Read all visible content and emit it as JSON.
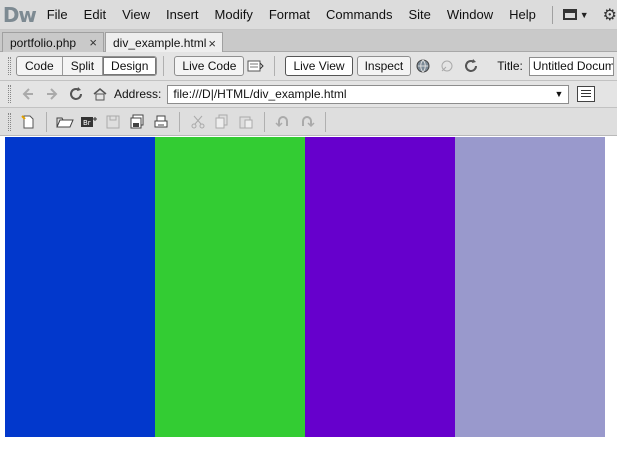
{
  "app": {
    "logo": "Dw"
  },
  "menu": [
    "File",
    "Edit",
    "View",
    "Insert",
    "Modify",
    "Format",
    "Commands",
    "Site",
    "Window",
    "Help"
  ],
  "tabs": [
    {
      "label": "portfolio.php",
      "close": "×"
    },
    {
      "label": "div_example.html",
      "close": "×"
    }
  ],
  "doc_toolbar": {
    "views": [
      "Code",
      "Split",
      "Design"
    ],
    "active_view": "Design",
    "live_code": "Live Code",
    "live_view": "Live View",
    "inspect": "Inspect",
    "title_label": "Title:",
    "title_value": "Untitled Document"
  },
  "browser": {
    "address_label": "Address:",
    "address_value": "file:///D|/HTML/div_example.html"
  },
  "columns": [
    {
      "color": "#0238cc"
    },
    {
      "color": "#33cc33"
    },
    {
      "color": "#6600cc"
    },
    {
      "color": "#9999cc"
    }
  ],
  "icons": {
    "back": "back-arrow-icon",
    "forward": "forward-arrow-icon",
    "refresh": "refresh-icon",
    "home": "home-icon"
  }
}
